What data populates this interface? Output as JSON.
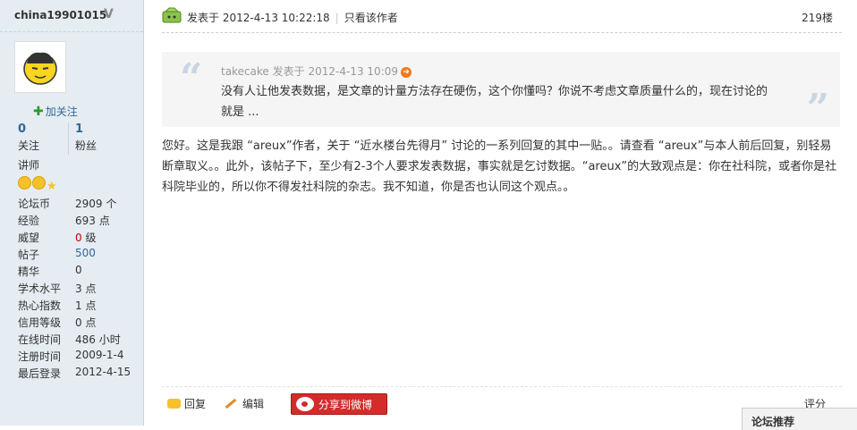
{
  "user": {
    "username": "china19901015",
    "verified_mark": "V",
    "follow_label": "加关注",
    "follow_count": "0",
    "follow_label2": "关注",
    "fans_count": "1",
    "fans_label": "粉丝",
    "rank": "讲师",
    "info": [
      {
        "key": "论坛币",
        "value": "2909 个"
      },
      {
        "key": "经验",
        "value": "693 点"
      },
      {
        "key": "威望",
        "value_num": "0",
        "value_unit": " 级"
      },
      {
        "key": "帖子",
        "value": "500"
      },
      {
        "key": "精华",
        "value": "0"
      },
      {
        "key": "学术水平",
        "value": "3 点"
      },
      {
        "key": "热心指数",
        "value": "1 点"
      },
      {
        "key": "信用等级",
        "value": "0 点"
      },
      {
        "key": "在线时间",
        "value": "486 小时"
      },
      {
        "key": "注册时间",
        "value": "2009-1-4"
      },
      {
        "key": "最后登录",
        "value": "2012-4-15"
      }
    ]
  },
  "post": {
    "posted_prefix": "发表于",
    "posted_time": "2012-4-13 10:22:18",
    "only_author": "只看该作者",
    "floor": "219楼",
    "quote": {
      "author": "takecake",
      "prefix": "发表于",
      "time": "2012-4-13 10:09",
      "text": "没有人让他发表数据，是文章的计量方法存在硬伤，这个你懂吗？你说不考虑文章质量什么的，现在讨论的就是 ..."
    },
    "body": "您好。这是我跟 “areux”作者，关于 “近水楼台先得月” 讨论的一系列回复的其中一贴。。请查看 “areux”与本人前后回复，别轻易断章取义。。此外，该帖子下，至少有2-3个人要求发表数据，事实就是乞讨数据。“areux”的大致观点是：你在社科院，或者你是社科院毕业的，所以你不得发社科院的杂志。我不知道，你是否也认同这个观点。。"
  },
  "actions": {
    "reply": "回复",
    "edit": "编辑",
    "share_weibo": "分享到微博",
    "rate": "评分"
  },
  "popup": {
    "title": "论坛推荐"
  },
  "colors": {
    "sidebar_bg": "#E5EDF2",
    "link_blue": "#336699",
    "weibo_red": "#D42B2B"
  }
}
